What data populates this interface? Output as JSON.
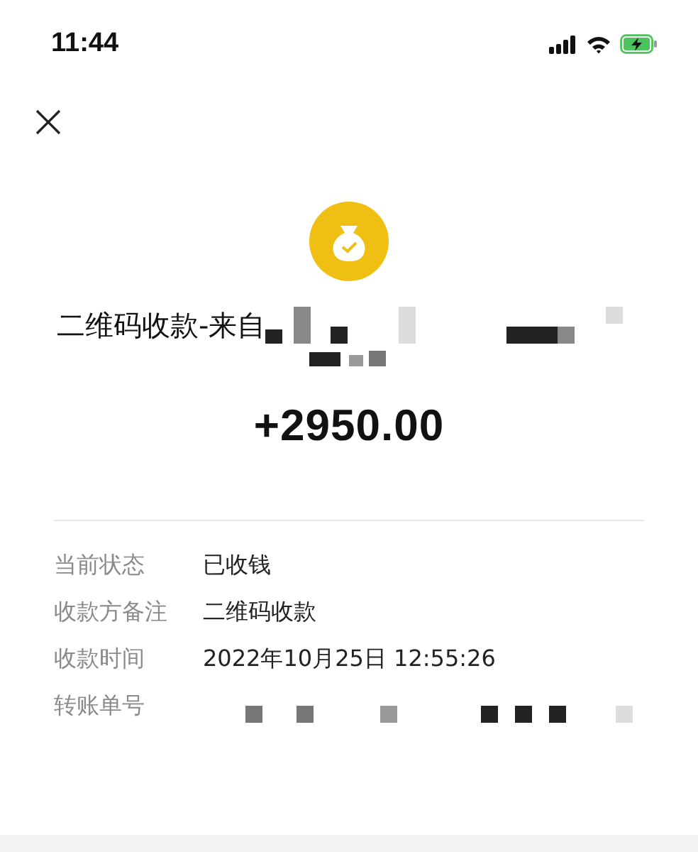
{
  "status_bar": {
    "time": "11:44",
    "battery_charging": true
  },
  "title": "二维码收款-来自",
  "amount": "+2950.00",
  "details": [
    {
      "kind": "text",
      "label": "当前状态",
      "value": "已收钱"
    },
    {
      "kind": "text",
      "label": "收款方备注",
      "value": "二维码收款"
    },
    {
      "kind": "text",
      "label": "收款时间",
      "value": "2022年10月25日 12:55:26"
    },
    {
      "kind": "redacted",
      "label": "转账单号"
    }
  ]
}
